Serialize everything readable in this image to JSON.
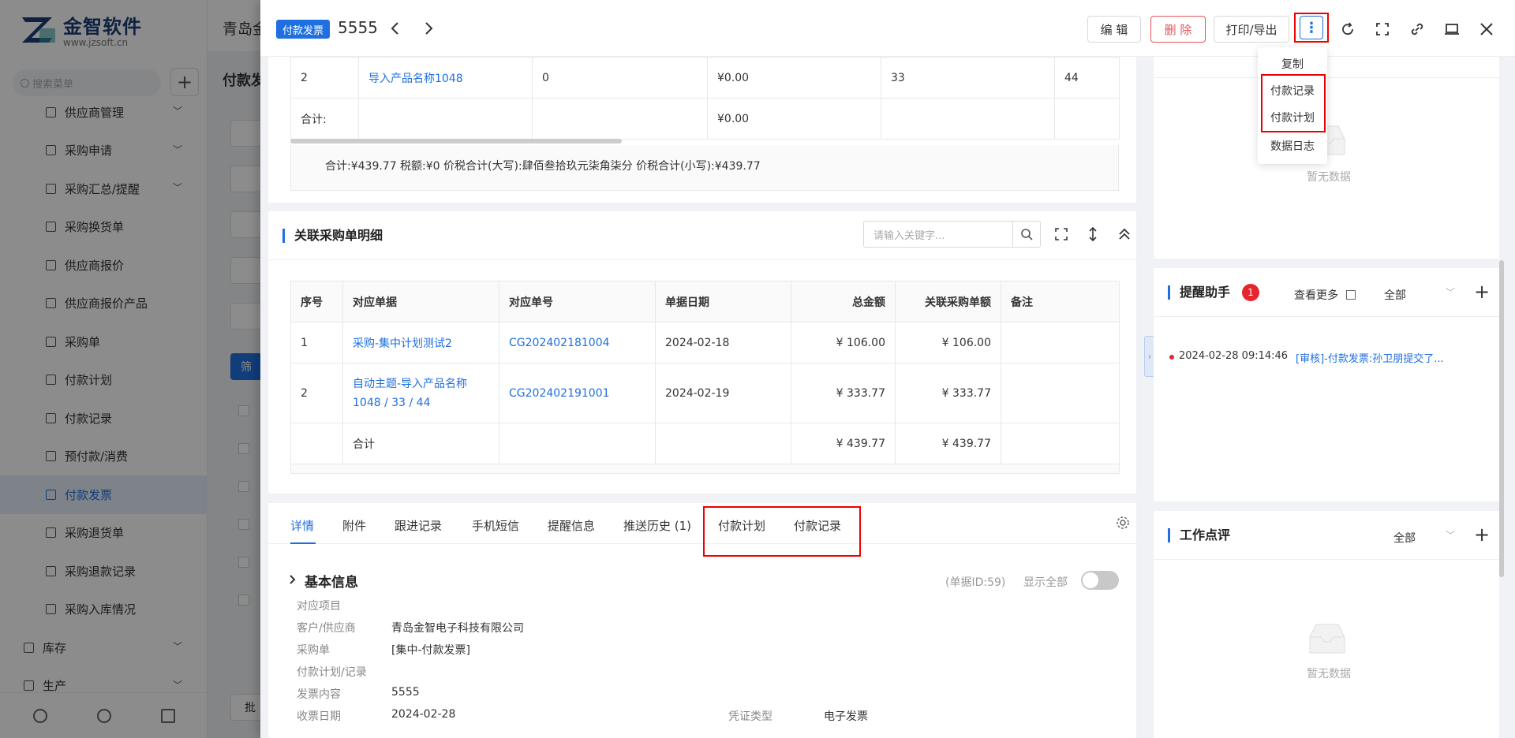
{
  "app": {
    "logo_title": "金智软件",
    "logo_url": "www.jzsoft.cn",
    "company": "青岛金",
    "page_title": "付款发",
    "search_placeholder": "搜索菜单",
    "filter_button": "筛",
    "batch_button": "批"
  },
  "sidebar": {
    "items": [
      {
        "label": "供应商管理",
        "chevron": true
      },
      {
        "label": "采购申请",
        "chevron": true
      },
      {
        "label": "采购汇总/提醒",
        "chevron": true
      },
      {
        "label": "采购换货单",
        "chevron": false
      },
      {
        "label": "供应商报价",
        "chevron": false
      },
      {
        "label": "供应商报价产品",
        "chevron": false
      },
      {
        "label": "采购单",
        "chevron": false
      },
      {
        "label": "付款计划",
        "chevron": false
      },
      {
        "label": "付款记录",
        "chevron": false
      },
      {
        "label": "预付款/消费",
        "chevron": false
      },
      {
        "label": "付款发票",
        "chevron": false,
        "active": true
      },
      {
        "label": "采购退货单",
        "chevron": false
      },
      {
        "label": "采购退款记录",
        "chevron": false
      },
      {
        "label": "采购入库情况",
        "chevron": false
      }
    ],
    "groups": [
      {
        "label": "库存"
      },
      {
        "label": "生产"
      }
    ]
  },
  "drawer": {
    "type_tag": "付款发票",
    "doc_no": "5555",
    "buttons": {
      "edit": "编 辑",
      "delete": "删 除",
      "print": "打印/导出"
    },
    "dropdown": [
      "复制",
      "付款记录",
      "付款计划",
      "数据日志"
    ]
  },
  "product_table": {
    "rows": [
      {
        "seq": "2",
        "name": "导入产品名称1048",
        "qty": "0",
        "amount": "¥0.00",
        "c5": "33",
        "c6": "44"
      }
    ],
    "total_label": "合计:",
    "total_amount": "¥0.00",
    "summary": "合计:¥439.77   税额:¥0   价税合计(大写):肆佰叁拾玖元柒角柒分   价税合计(小写):¥439.77"
  },
  "related": {
    "title": "关联采购单明细",
    "search_placeholder": "请输入关键字...",
    "headers": [
      "序号",
      "对应单据",
      "对应单号",
      "单据日期",
      "总金额",
      "关联采购单额",
      "备注"
    ],
    "rows": [
      {
        "seq": "1",
        "doc": "采购-集中计划测试2",
        "no": "CG202402181004",
        "date": "2024-02-18",
        "total": "¥ 106.00",
        "related": "¥ 106.00",
        "note": ""
      },
      {
        "seq": "2",
        "doc": "自动主题-导入产品名称1048 / 33 / 44",
        "no": "CG202402191001",
        "date": "2024-02-19",
        "total": "¥ 333.77",
        "related": "¥ 333.77",
        "note": ""
      }
    ],
    "total_label": "合计",
    "total_total": "¥ 439.77",
    "total_related": "¥ 439.77"
  },
  "tabs": [
    "详情",
    "附件",
    "跟进记录",
    "手机短信",
    "提醒信息",
    "推送历史 (1)",
    "付款计划",
    "付款记录"
  ],
  "basic_info": {
    "title": "基本信息",
    "doc_id": "(单据ID:59)",
    "show_all": "显示全部",
    "fields": [
      {
        "label": "对应项目",
        "value": ""
      },
      {
        "label": "客户/供应商",
        "value": "青岛金智电子科技有限公司",
        "link": true
      },
      {
        "label": "采购单",
        "value": "[集中-付款发票]",
        "link": true
      },
      {
        "label": "付款计划/记录",
        "value": ""
      },
      {
        "label": "发票内容",
        "value": "5555"
      },
      {
        "label": "收票日期",
        "value": "2024-02-28"
      }
    ],
    "voucher_label": "凭证类型",
    "voucher_value": "电子发票"
  },
  "right": {
    "empty_text": "暂无数据",
    "reminder": {
      "title": "提醒助手",
      "badge": "1",
      "more": "查看更多",
      "filter": "全部",
      "item_time": "2024-02-28 09:14:46",
      "item_text": "[审核]-付款发票:孙卫朋提交了..."
    },
    "review": {
      "title": "工作点评",
      "filter": "全部"
    }
  }
}
